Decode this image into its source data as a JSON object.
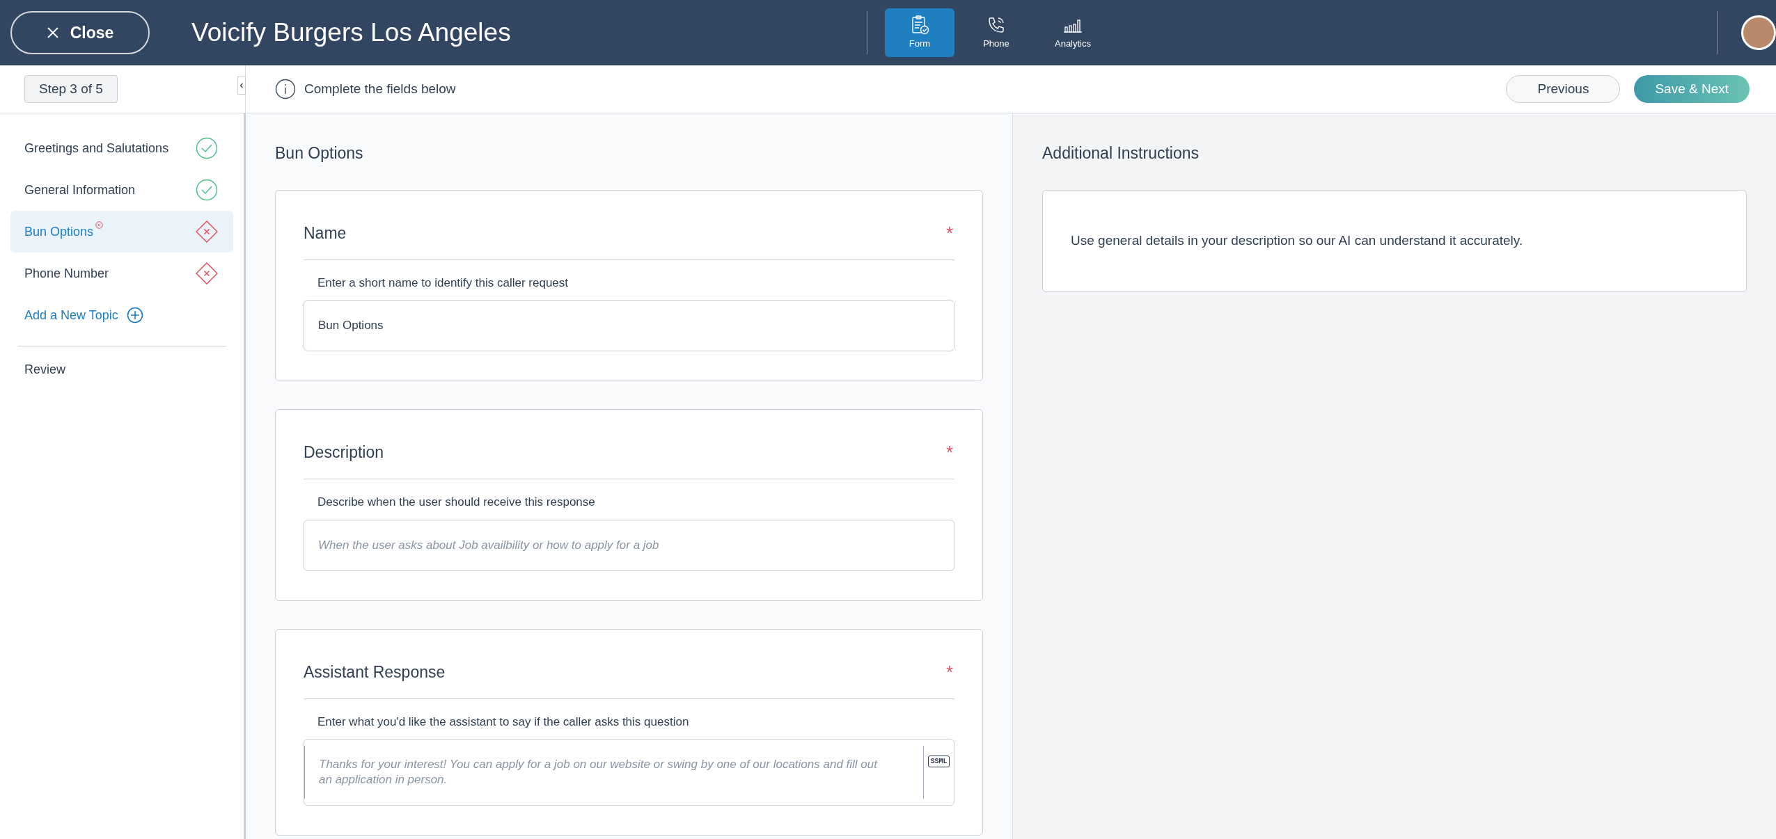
{
  "header": {
    "close_label": "Close",
    "title": "Voicify Burgers Los Angeles",
    "nav": [
      {
        "label": "Form",
        "selected": true
      },
      {
        "label": "Phone",
        "selected": false
      },
      {
        "label": "Analytics",
        "selected": false
      }
    ]
  },
  "toolbar": {
    "step": "Step 3 of 5",
    "hint": "Complete the fields below",
    "buttons": [
      {
        "label": "Previous",
        "kind": "secondary"
      },
      {
        "label": "Save & Next",
        "kind": "primary"
      }
    ]
  },
  "sidebar": {
    "items": [
      {
        "label": "Greetings and Salutations",
        "kind": "done",
        "selected": false,
        "flagged": false
      },
      {
        "label": "General Information",
        "kind": "done",
        "selected": false,
        "flagged": false
      },
      {
        "label": "Bun Options",
        "kind": "error",
        "selected": true,
        "flagged": true
      },
      {
        "label": "Phone Number",
        "kind": "error",
        "selected": false,
        "flagged": false
      }
    ],
    "add_label": "Add a New Topic",
    "review_label": "Review"
  },
  "form": {
    "title": "Bun Options",
    "sections": [
      {
        "title": "Name",
        "required_mark": "*",
        "hint": "Enter a short name to identify this caller request",
        "value": "Bun Options",
        "kind": "input"
      },
      {
        "title": "Description",
        "required_mark": "*",
        "hint": "Describe when the user should receive this response",
        "placeholder": "When the user asks about Job availbility or how to apply for a job",
        "kind": "input"
      },
      {
        "title": "Assistant Response",
        "required_mark": "*",
        "hint": "Enter what you'd like the assistant to say if the caller asks this question",
        "placeholder": "Thanks for your interest! You can apply for a job on our website or swing by one of our locations and fill out an application in person.",
        "kind": "textarea",
        "tool": "SSML"
      }
    ]
  },
  "instructions": {
    "title": "Additional Instructions",
    "text": "Use general details in your description so our AI can understand it accurately."
  }
}
